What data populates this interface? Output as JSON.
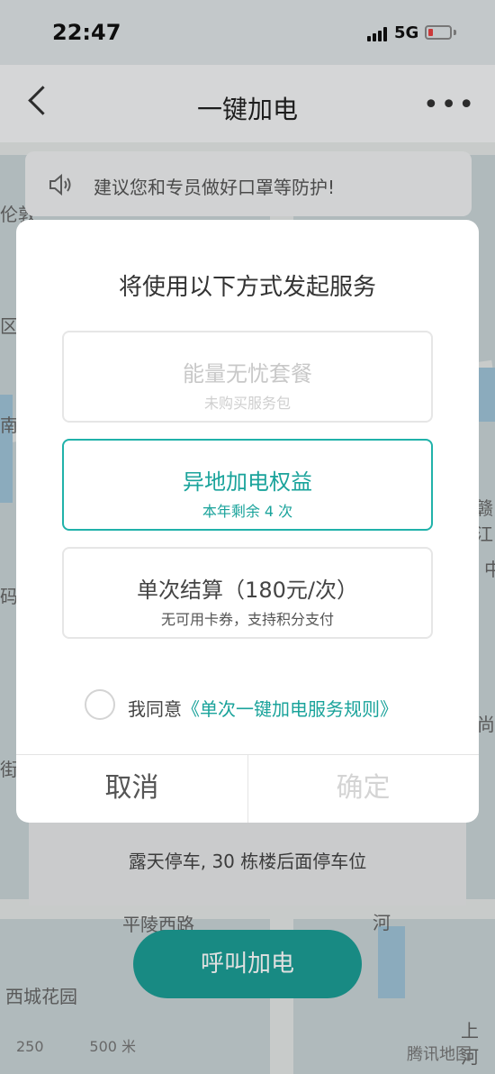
{
  "status_bar": {
    "time": "22:47",
    "network": "5G",
    "battery_level": 0.12,
    "battery_color": "#e84141"
  },
  "nav": {
    "title": "一键加电",
    "more_label": "•••"
  },
  "tip": {
    "text": "建议您和专员做好口罩等防护!"
  },
  "map": {
    "labels": [
      "伦敦",
      "区",
      "南",
      "码头",
      "街",
      "赣江",
      "中",
      "尚",
      "平陵西路",
      "西城花园",
      "河",
      "上河"
    ],
    "scale_labels": [
      "250",
      "500 米"
    ],
    "provider": "腾讯地图"
  },
  "dialog": {
    "title": "将使用以下方式发起服务",
    "options": [
      {
        "title": "能量无忧套餐",
        "subtitle": "未购买服务包",
        "state": "disabled"
      },
      {
        "title": "异地加电权益",
        "subtitle": "本年剩余 4 次",
        "state": "selected"
      },
      {
        "title": "单次结算（180元/次）",
        "subtitle": "无可用卡券，支持积分支付",
        "state": "normal"
      }
    ],
    "agreement": {
      "prefix": "我同意",
      "link": "《单次一键加电服务规则》",
      "checked": false
    },
    "cancel_label": "取消",
    "confirm_label": "确定"
  },
  "parking_note": "露天停车, 30 栋楼后面停车位",
  "call_button": "呼叫加电",
  "colors": {
    "accent": "#20b2aa",
    "call_button": "#1c9e96"
  }
}
